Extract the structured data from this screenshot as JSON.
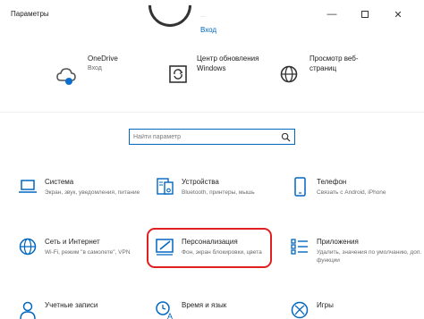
{
  "window": {
    "title": "Параметры",
    "minimize_glyph": "—",
    "close_glyph": "✕"
  },
  "account": {
    "faded_text": "...",
    "signin_label": "Вход"
  },
  "top_items": [
    {
      "label": "OneDrive",
      "sub": "Вход",
      "icon": "onedrive-cloud-icon"
    },
    {
      "label": "Центр обновления Windows",
      "sub": "",
      "icon": "windows-update-icon"
    },
    {
      "label": "Просмотр веб-страниц",
      "sub": "",
      "icon": "globe-icon"
    }
  ],
  "search": {
    "placeholder": "Найти параметр"
  },
  "tiles": [
    {
      "name": "Система",
      "desc": "Экран, звук, уведомления, питание",
      "icon": "laptop-icon"
    },
    {
      "name": "Устройства",
      "desc": "Bluetooth, принтеры, мышь",
      "icon": "keyboard-devices-icon"
    },
    {
      "name": "Телефон",
      "desc": "Связать с Android, iPhone",
      "icon": "phone-icon"
    },
    {
      "name": "Сеть и Интернет",
      "desc": "Wi-Fi, режим \"в самолете\", VPN",
      "icon": "network-globe-icon"
    },
    {
      "name": "Персонализация",
      "desc": "Фон, экран блокировки, цвета",
      "icon": "personalization-brush-icon"
    },
    {
      "name": "Приложения",
      "desc": "Удалить, значения по умолчанию, доп. функции",
      "icon": "apps-list-icon"
    },
    {
      "name": "Учетные записи",
      "desc": "",
      "icon": "account-icon"
    },
    {
      "name": "Время и язык",
      "desc": "",
      "icon": "time-language-icon"
    },
    {
      "name": "Игры",
      "desc": "",
      "icon": "xbox-icon"
    }
  ],
  "colors": {
    "accent": "#0067c0",
    "highlight": "#e02020"
  }
}
